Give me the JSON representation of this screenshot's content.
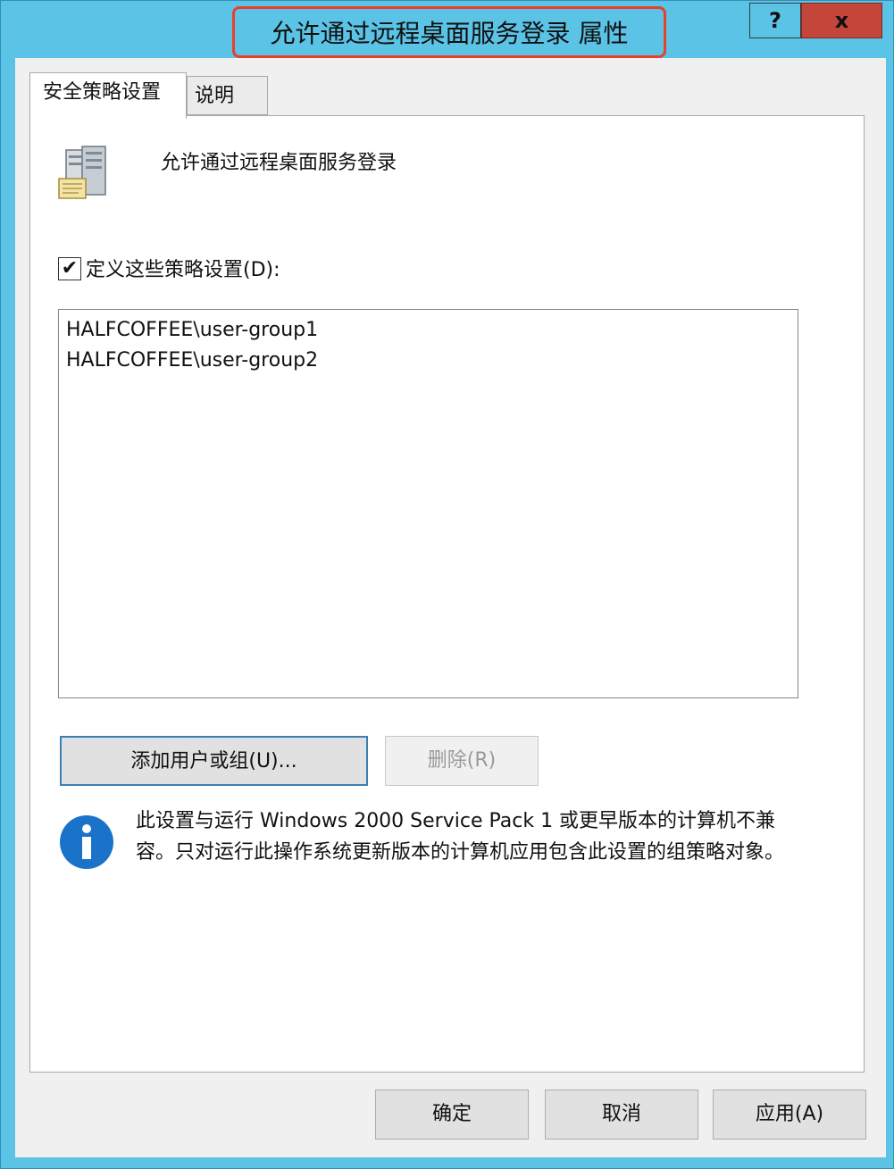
{
  "window": {
    "title": "允许通过远程桌面服务登录 属性",
    "help_label": "?",
    "close_label": "x"
  },
  "tabs": [
    {
      "label": "安全策略设置"
    },
    {
      "label": "说明"
    }
  ],
  "policy": {
    "name": "允许通过远程桌面服务登录",
    "icon": "server-policy-icon"
  },
  "define_checkbox": {
    "label": "定义这些策略设置(D):",
    "checked": true,
    "mark": "✔"
  },
  "members": [
    "HALFCOFFEE\\user-group1",
    "HALFCOFFEE\\user-group2"
  ],
  "buttons": {
    "add": "添加用户或组(U)...",
    "remove": "删除(R)",
    "ok": "确定",
    "cancel": "取消",
    "apply": "应用(A)"
  },
  "info": {
    "icon": "info-icon",
    "text": "此设置与运行 Windows 2000 Service Pack 1 或更早版本的计算机不兼容。只对运行此操作系统更新版本的计算机应用包含此设置的组策略对象。"
  },
  "colors": {
    "titlebar": "#5bc3e6",
    "close": "#c4463b",
    "highlight": "#e8402b",
    "info_blue": "#1a73c8"
  }
}
